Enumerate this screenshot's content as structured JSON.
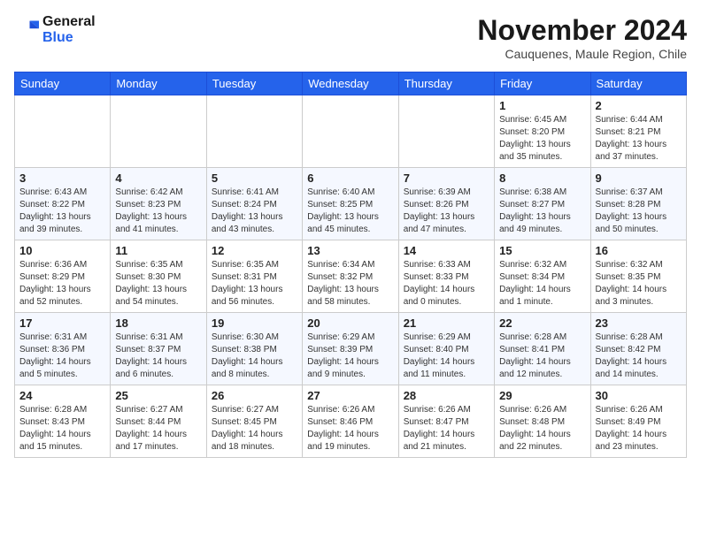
{
  "logo": {
    "line1": "General",
    "line2": "Blue"
  },
  "title": "November 2024",
  "subtitle": "Cauquenes, Maule Region, Chile",
  "weekdays": [
    "Sunday",
    "Monday",
    "Tuesday",
    "Wednesday",
    "Thursday",
    "Friday",
    "Saturday"
  ],
  "weeks": [
    [
      {
        "day": "",
        "content": ""
      },
      {
        "day": "",
        "content": ""
      },
      {
        "day": "",
        "content": ""
      },
      {
        "day": "",
        "content": ""
      },
      {
        "day": "",
        "content": ""
      },
      {
        "day": "1",
        "content": "Sunrise: 6:45 AM\nSunset: 8:20 PM\nDaylight: 13 hours\nand 35 minutes."
      },
      {
        "day": "2",
        "content": "Sunrise: 6:44 AM\nSunset: 8:21 PM\nDaylight: 13 hours\nand 37 minutes."
      }
    ],
    [
      {
        "day": "3",
        "content": "Sunrise: 6:43 AM\nSunset: 8:22 PM\nDaylight: 13 hours\nand 39 minutes."
      },
      {
        "day": "4",
        "content": "Sunrise: 6:42 AM\nSunset: 8:23 PM\nDaylight: 13 hours\nand 41 minutes."
      },
      {
        "day": "5",
        "content": "Sunrise: 6:41 AM\nSunset: 8:24 PM\nDaylight: 13 hours\nand 43 minutes."
      },
      {
        "day": "6",
        "content": "Sunrise: 6:40 AM\nSunset: 8:25 PM\nDaylight: 13 hours\nand 45 minutes."
      },
      {
        "day": "7",
        "content": "Sunrise: 6:39 AM\nSunset: 8:26 PM\nDaylight: 13 hours\nand 47 minutes."
      },
      {
        "day": "8",
        "content": "Sunrise: 6:38 AM\nSunset: 8:27 PM\nDaylight: 13 hours\nand 49 minutes."
      },
      {
        "day": "9",
        "content": "Sunrise: 6:37 AM\nSunset: 8:28 PM\nDaylight: 13 hours\nand 50 minutes."
      }
    ],
    [
      {
        "day": "10",
        "content": "Sunrise: 6:36 AM\nSunset: 8:29 PM\nDaylight: 13 hours\nand 52 minutes."
      },
      {
        "day": "11",
        "content": "Sunrise: 6:35 AM\nSunset: 8:30 PM\nDaylight: 13 hours\nand 54 minutes."
      },
      {
        "day": "12",
        "content": "Sunrise: 6:35 AM\nSunset: 8:31 PM\nDaylight: 13 hours\nand 56 minutes."
      },
      {
        "day": "13",
        "content": "Sunrise: 6:34 AM\nSunset: 8:32 PM\nDaylight: 13 hours\nand 58 minutes."
      },
      {
        "day": "14",
        "content": "Sunrise: 6:33 AM\nSunset: 8:33 PM\nDaylight: 14 hours\nand 0 minutes."
      },
      {
        "day": "15",
        "content": "Sunrise: 6:32 AM\nSunset: 8:34 PM\nDaylight: 14 hours\nand 1 minute."
      },
      {
        "day": "16",
        "content": "Sunrise: 6:32 AM\nSunset: 8:35 PM\nDaylight: 14 hours\nand 3 minutes."
      }
    ],
    [
      {
        "day": "17",
        "content": "Sunrise: 6:31 AM\nSunset: 8:36 PM\nDaylight: 14 hours\nand 5 minutes."
      },
      {
        "day": "18",
        "content": "Sunrise: 6:31 AM\nSunset: 8:37 PM\nDaylight: 14 hours\nand 6 minutes."
      },
      {
        "day": "19",
        "content": "Sunrise: 6:30 AM\nSunset: 8:38 PM\nDaylight: 14 hours\nand 8 minutes."
      },
      {
        "day": "20",
        "content": "Sunrise: 6:29 AM\nSunset: 8:39 PM\nDaylight: 14 hours\nand 9 minutes."
      },
      {
        "day": "21",
        "content": "Sunrise: 6:29 AM\nSunset: 8:40 PM\nDaylight: 14 hours\nand 11 minutes."
      },
      {
        "day": "22",
        "content": "Sunrise: 6:28 AM\nSunset: 8:41 PM\nDaylight: 14 hours\nand 12 minutes."
      },
      {
        "day": "23",
        "content": "Sunrise: 6:28 AM\nSunset: 8:42 PM\nDaylight: 14 hours\nand 14 minutes."
      }
    ],
    [
      {
        "day": "24",
        "content": "Sunrise: 6:28 AM\nSunset: 8:43 PM\nDaylight: 14 hours\nand 15 minutes."
      },
      {
        "day": "25",
        "content": "Sunrise: 6:27 AM\nSunset: 8:44 PM\nDaylight: 14 hours\nand 17 minutes."
      },
      {
        "day": "26",
        "content": "Sunrise: 6:27 AM\nSunset: 8:45 PM\nDaylight: 14 hours\nand 18 minutes."
      },
      {
        "day": "27",
        "content": "Sunrise: 6:26 AM\nSunset: 8:46 PM\nDaylight: 14 hours\nand 19 minutes."
      },
      {
        "day": "28",
        "content": "Sunrise: 6:26 AM\nSunset: 8:47 PM\nDaylight: 14 hours\nand 21 minutes."
      },
      {
        "day": "29",
        "content": "Sunrise: 6:26 AM\nSunset: 8:48 PM\nDaylight: 14 hours\nand 22 minutes."
      },
      {
        "day": "30",
        "content": "Sunrise: 6:26 AM\nSunset: 8:49 PM\nDaylight: 14 hours\nand 23 minutes."
      }
    ]
  ]
}
